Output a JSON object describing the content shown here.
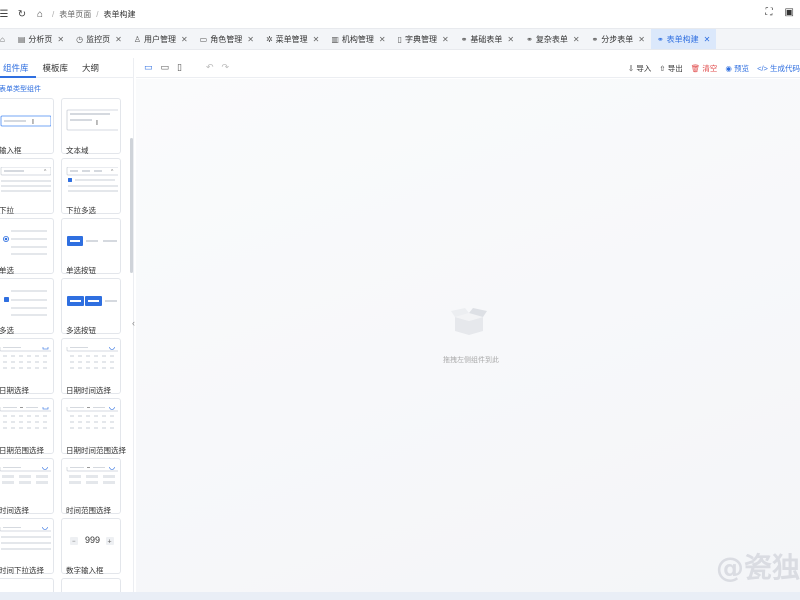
{
  "header": {
    "breadcrumb": [
      "表单页面",
      "表单构建"
    ]
  },
  "tabs": [
    {
      "label": "分析页",
      "icon": "chart-icon"
    },
    {
      "label": "监控页",
      "icon": "monitor-icon"
    },
    {
      "label": "用户管理",
      "icon": "user-icon"
    },
    {
      "label": "角色管理",
      "icon": "role-icon"
    },
    {
      "label": "菜单管理",
      "icon": "menu-icon"
    },
    {
      "label": "机构管理",
      "icon": "org-icon"
    },
    {
      "label": "字典管理",
      "icon": "dict-icon"
    },
    {
      "label": "基础表单",
      "icon": "link-icon"
    },
    {
      "label": "复杂表单",
      "icon": "link-icon"
    },
    {
      "label": "分步表单",
      "icon": "link-icon"
    },
    {
      "label": "表单构建",
      "icon": "link-icon",
      "active": true
    }
  ],
  "left_panel": {
    "tabs": [
      "组件库",
      "模板库",
      "大纲"
    ],
    "section_title": "表单类型组件",
    "components": [
      "输入框",
      "文本域",
      "下拉",
      "下拉多选",
      "单选",
      "单选按钮",
      "多选",
      "多选按钮",
      "日期选择",
      "日期时间选择",
      "日期范围选择",
      "日期时间范围选择",
      "时间选择",
      "时间范围选择",
      "时间下拉选择",
      "数字输入框"
    ],
    "number_value": "999"
  },
  "toolbar": {
    "import": "导入",
    "export": "导出",
    "clear": "清空",
    "preview": "预览",
    "generate": "生成代码"
  },
  "canvas": {
    "empty_text": "拖拽左侧组件到此"
  },
  "watermark": "@瓷独"
}
